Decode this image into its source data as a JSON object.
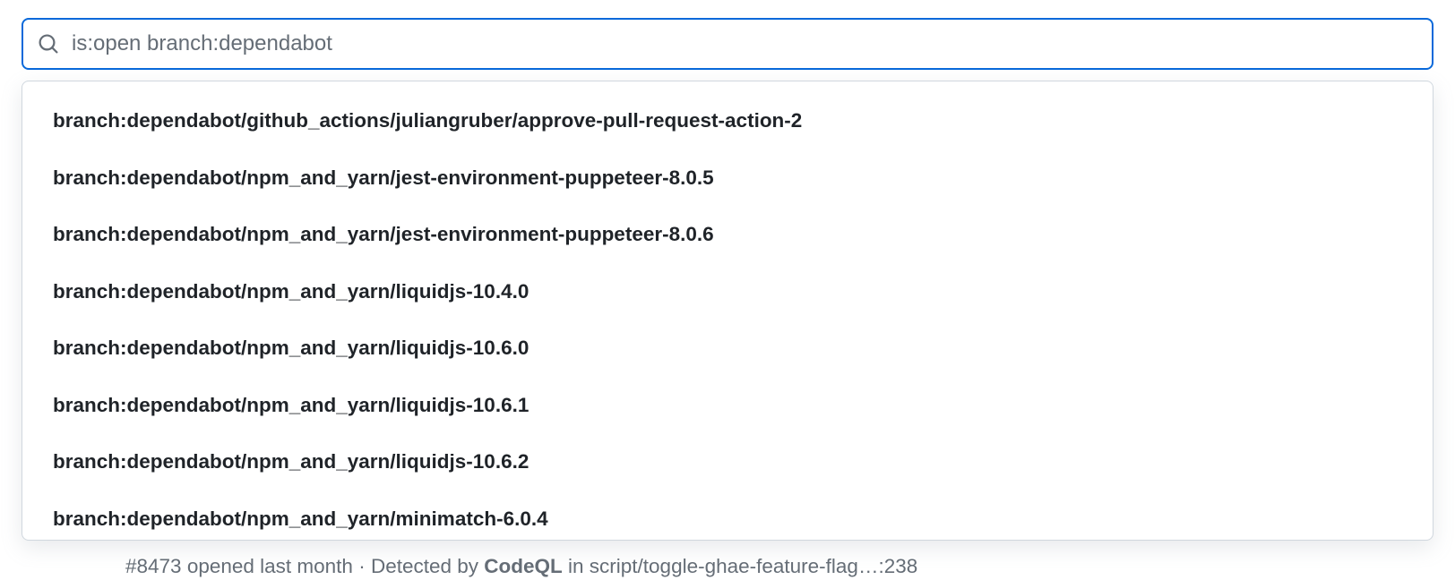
{
  "search": {
    "value": "is:open branch:dependabot",
    "placeholder": ""
  },
  "suggestions": [
    "branch:dependabot/github_actions/juliangruber/approve-pull-request-action-2",
    "branch:dependabot/npm_and_yarn/jest-environment-puppeteer-8.0.5",
    "branch:dependabot/npm_and_yarn/jest-environment-puppeteer-8.0.6",
    "branch:dependabot/npm_and_yarn/liquidjs-10.4.0",
    "branch:dependabot/npm_and_yarn/liquidjs-10.6.0",
    "branch:dependabot/npm_and_yarn/liquidjs-10.6.1",
    "branch:dependabot/npm_and_yarn/liquidjs-10.6.2",
    "branch:dependabot/npm_and_yarn/minimatch-6.0.4"
  ],
  "background": {
    "prefix": "#8473 opened last month · Detected by ",
    "strong": "CodeQL",
    "suffix": " in script/toggle-ghae-feature-flag…:238"
  }
}
